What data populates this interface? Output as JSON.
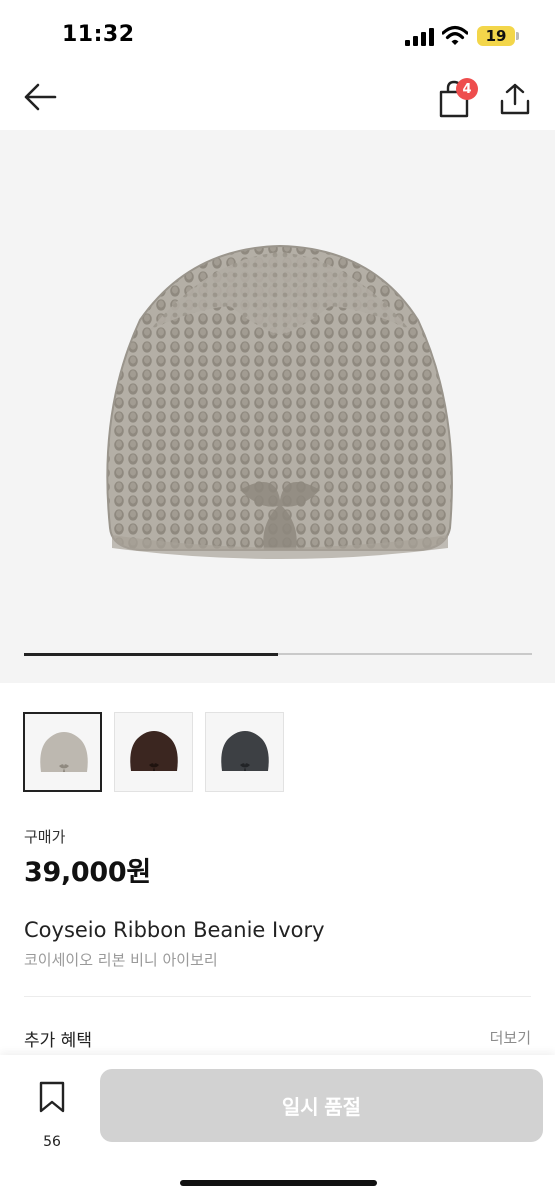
{
  "status_bar": {
    "time": "11:32",
    "battery": "19"
  },
  "header": {
    "cart_count": "4"
  },
  "gallery": {
    "progress": 0.5
  },
  "thumbnails": [
    {
      "color": "#bdb8b0"
    },
    {
      "color": "#3b2620"
    },
    {
      "color": "#3d4044"
    }
  ],
  "product": {
    "price_label": "구매가",
    "price": "39,000원",
    "name_en": "Coyseio Ribbon Beanie Ivory",
    "name_ko": "코이세이오 리본 비니 아이보리"
  },
  "benefits": {
    "label": "추가 혜택",
    "more": "더보기"
  },
  "bottom": {
    "bookmark_count": "56",
    "cta": "일시 품절"
  },
  "colors": {
    "badge": "#ee4d4d",
    "cta_disabled": "#d2d2d2"
  }
}
